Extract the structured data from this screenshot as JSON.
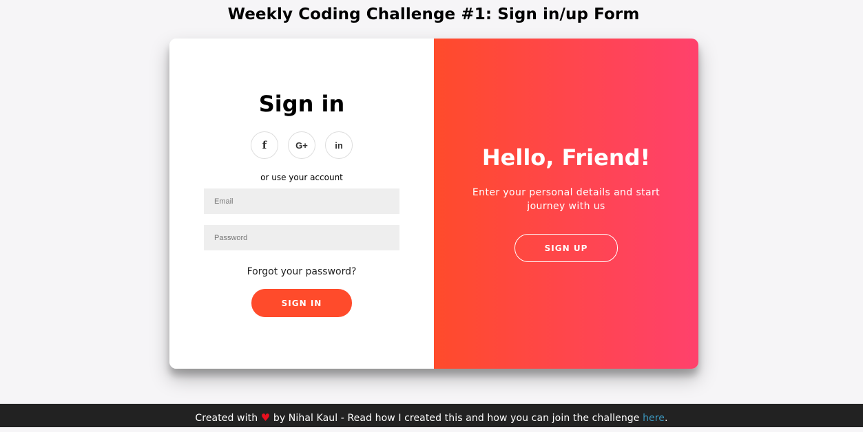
{
  "page": {
    "title": "Weekly Coding Challenge #1: Sign in/up Form"
  },
  "signin": {
    "title": "Sign in",
    "social": [
      {
        "icon": "facebook-icon",
        "glyph": "f"
      },
      {
        "icon": "google-plus-icon",
        "glyph": "G+"
      },
      {
        "icon": "linkedin-icon",
        "glyph": "in"
      }
    ],
    "alt_text": "or use your account",
    "email_placeholder": "Email",
    "email_value": "",
    "password_placeholder": "Password",
    "password_value": "",
    "forgot_label": "Forgot your password?",
    "button_label": "SIGN IN"
  },
  "overlay": {
    "title": "Hello, Friend!",
    "text": "Enter your personal details and start journey with us",
    "button_label": "SIGN UP"
  },
  "footer": {
    "prefix": "Created with",
    "heart_icon": "heart-icon",
    "heart_glyph": "♥",
    "middle": "by Nihal Kaul - Read how I created this and how you can join the challenge",
    "link_label": "here",
    "suffix": "."
  },
  "colors": {
    "accent": "#ff4b2b",
    "gradient_start": "#ff4b2b",
    "gradient_end": "#ff416c",
    "footer_bg": "#222222",
    "footer_link": "#3c97bf"
  }
}
